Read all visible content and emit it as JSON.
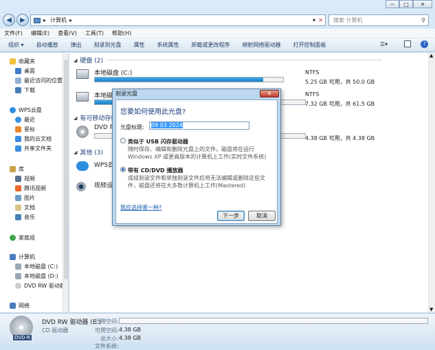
{
  "titlebar": {
    "minimize": "─",
    "maximize": "□",
    "close": "✕"
  },
  "address": {
    "path": "计算机",
    "search_placeholder": "搜索 计算机"
  },
  "menubar": [
    "文件(F)",
    "编辑(E)",
    "查看(V)",
    "工具(T)",
    "帮助(H)"
  ],
  "toolbar": [
    "组织 ▾",
    "自动播放",
    "弹出",
    "刻录到光盘",
    "属性",
    "系统属性",
    "卸载或更改程序",
    "映射网络驱动器",
    "打开控制面板"
  ],
  "sidebar": {
    "favorites": "收藏夹",
    "fav_items": [
      "桌面",
      "最近访问的位置",
      "下载"
    ],
    "wps": "WPS云盘",
    "wps_items": [
      "最近",
      "星标",
      "我的云文档",
      "共享文件夹"
    ],
    "library": "库",
    "lib_items": [
      "视频",
      "腾讯视频",
      "图片",
      "文档",
      "音乐"
    ],
    "homegroup": "家庭组",
    "computer": "计算机",
    "comp_items": [
      "本地磁盘 (C:)",
      "本地磁盘 (D:)",
      "DVD RW 驱动器"
    ],
    "network": "网络"
  },
  "content": {
    "group_hdd": "硬盘 (2)",
    "group_removable": "有可移动存储",
    "group_other": "其他 (3)",
    "drives": [
      {
        "name": "本地磁盘 (C:)",
        "fs": "NTFS",
        "free": "5.25 GB 可用，共 50.0 GB",
        "used_fraction": 0.895
      },
      {
        "name": "本地磁",
        "fs": "NTFS",
        "free": "7.32 GB 可用，共 61.5 GB",
        "used_fraction": 0.88
      },
      {
        "name": "DVD R",
        "fs": "",
        "free": "4.38 GB 可用，共 4.38 GB",
        "used_fraction": 0.0
      }
    ],
    "other_items": [
      "WPS云",
      "视频设"
    ]
  },
  "dialog": {
    "title": "刻录光盘",
    "close": "✕",
    "question": "您要如何使用此光盘?",
    "title_label": "光盘标题:",
    "title_value": "09 03 2024",
    "option1_title": "类似于 USB 闪存驱动器",
    "option1_desc": "随时保存、编辑和删除光盘上的文件。磁盘将在运行 Windows XP 或更高版本的计算机上工作(实时文件系统)",
    "option2_title": "带有 CD/DVD 播放器",
    "option2_desc": "成组刻录文件和单独刻录文件后将无法编辑或删除这些文件，磁盘还将在大多数计算机上工作(Mastered)",
    "help_link": "我应选择哪一种?",
    "next": "下一步",
    "cancel": "取消"
  },
  "details": {
    "name": "DVD RW 驱动器 (E:)",
    "type": "CD 驱动器",
    "used_label": "已用空间:",
    "free_label": "可用空间:",
    "free_value": "4.38 GB",
    "total_label": "总大小:",
    "total_value": "4.38 GB",
    "fs_label": "文件系统:",
    "disc_label": "DVD-R"
  },
  "colors": {
    "accent": "#1f7fc6",
    "link": "#1a5fb4"
  }
}
